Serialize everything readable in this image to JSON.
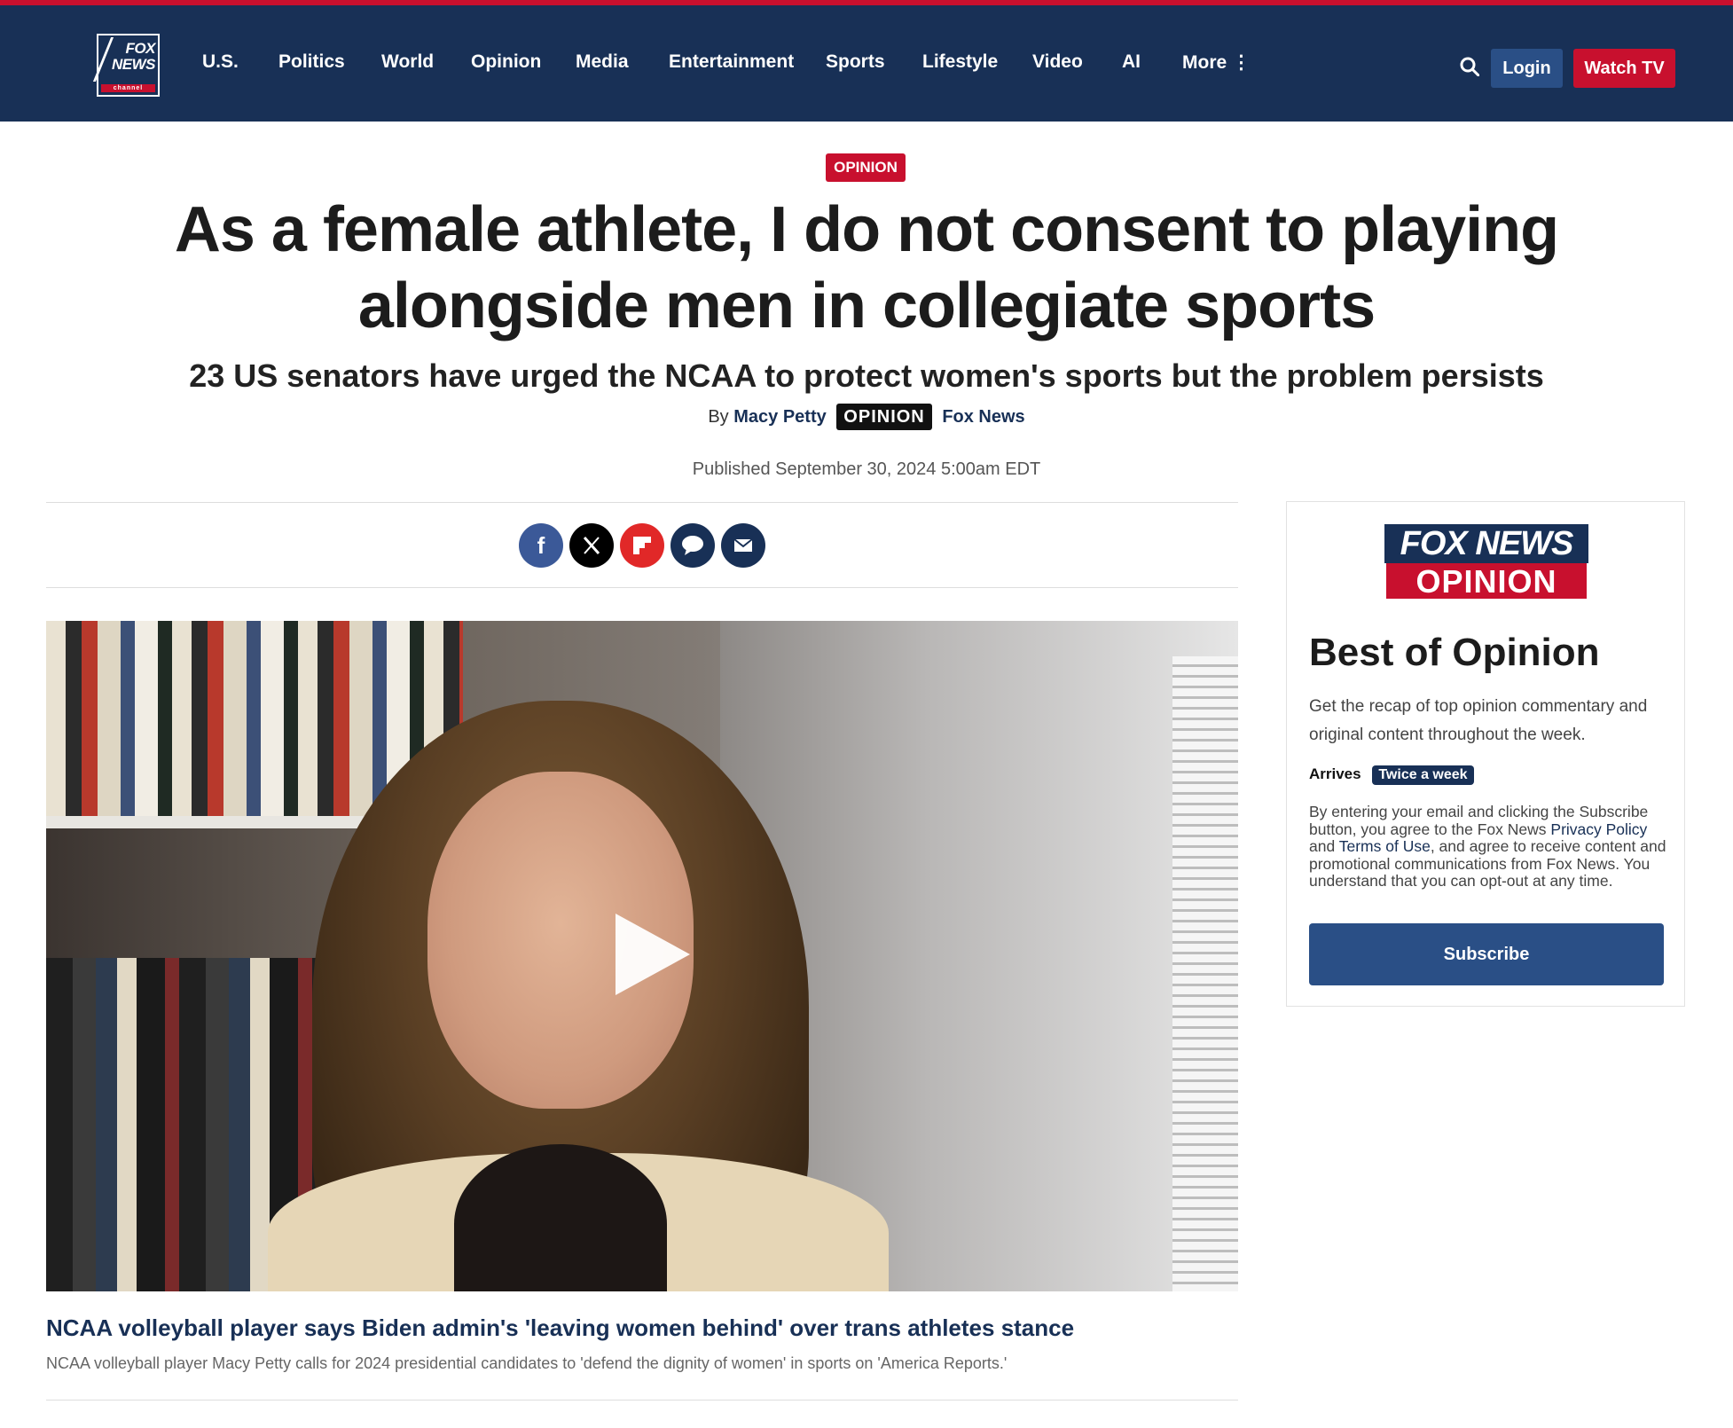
{
  "header": {
    "logo_text_line1": "FOX",
    "logo_text_line2": "NEWS",
    "logo_channel": "channel",
    "nav": [
      {
        "label": "U.S."
      },
      {
        "label": "Politics"
      },
      {
        "label": "World"
      },
      {
        "label": "Opinion"
      },
      {
        "label": "Media"
      },
      {
        "label": "Entertainment"
      },
      {
        "label": "Sports"
      },
      {
        "label": "Lifestyle"
      },
      {
        "label": "Video"
      },
      {
        "label": "AI"
      },
      {
        "label": "More ⋮"
      }
    ],
    "search_icon": "search-icon",
    "login_label": "Login",
    "watch_label": "Watch TV",
    "colors": {
      "navy": "#183056",
      "red": "#c8102e"
    }
  },
  "article": {
    "eyebrow": "OPINION",
    "headline": "As a female athlete, I do not consent to playing alongside men in collegiate sports",
    "subhead": "23 US senators have urged the NCAA to protect women's sports but the problem persists",
    "byline_prefix": "By",
    "author": "Macy Petty",
    "byline_tag": "OPINION",
    "outlet": "Fox News",
    "published": "Published September 30, 2024 5:00am EDT"
  },
  "share": [
    {
      "icon": "facebook-icon",
      "glyph": "f",
      "color": "#3b5998"
    },
    {
      "icon": "x-icon",
      "glyph": "𝕏",
      "color": "#000000"
    },
    {
      "icon": "flipboard-icon",
      "glyph": "F",
      "color": "#e12828"
    },
    {
      "icon": "comment-icon",
      "glyph": "💬",
      "color": "#183056"
    },
    {
      "icon": "email-icon",
      "glyph": "✉",
      "color": "#183056"
    }
  ],
  "video": {
    "play_icon": "play-icon",
    "title": "NCAA volleyball player says Biden admin's 'leaving women behind' over trans athletes stance",
    "description": "NCAA volleyball player Macy Petty calls for 2024 presidential candidates to 'defend the dignity of women' in sports on 'America Reports.'"
  },
  "sidebar": {
    "logo_top": "FOX NEWS",
    "logo_bottom": "OPINION",
    "title": "Best of Opinion",
    "description": "Get the recap of top opinion commentary and original content throughout the week.",
    "arrives_label": "Arrives",
    "frequency": "Twice a week",
    "legal_part1": "By entering your email and clicking the Subscribe button, you agree to the Fox News ",
    "privacy_link": "Privacy Policy",
    "legal_and": " and ",
    "terms_link": "Terms of Use",
    "legal_part2": ", and agree to receive content and promotional communications from Fox News. You understand that you can opt-out at any time.",
    "subscribe_label": "Subscribe"
  }
}
